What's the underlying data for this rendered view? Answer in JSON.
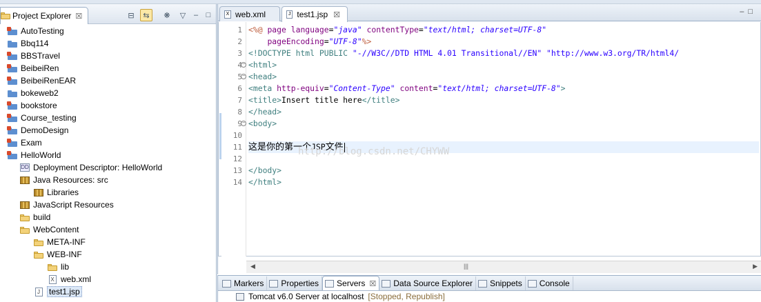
{
  "explorer": {
    "tab_label": "Project Explorer",
    "tab_close": "☒",
    "toolbar": {
      "collapse_all": "⊟",
      "link_editor": "⇆",
      "filter": "❋",
      "menu": "▽",
      "minimize": "–",
      "maximize": "□"
    },
    "tree": [
      {
        "label": "AutoTesting",
        "icon": "project-error-icon",
        "depth": 0
      },
      {
        "label": "Bbq114",
        "icon": "project-icon",
        "depth": 0
      },
      {
        "label": "BBSTravel",
        "icon": "web-project-icon",
        "depth": 0
      },
      {
        "label": "BeibeiRen",
        "icon": "web-project-icon",
        "depth": 0
      },
      {
        "label": "BeibeiRenEAR",
        "icon": "ear-project-icon",
        "depth": 0
      },
      {
        "label": "bokeweb2",
        "icon": "project-icon",
        "depth": 0
      },
      {
        "label": "bookstore",
        "icon": "project-error-icon",
        "depth": 0
      },
      {
        "label": "Course_testing",
        "icon": "web-project-icon",
        "depth": 0
      },
      {
        "label": "DemoDesign",
        "icon": "web-project-icon",
        "depth": 0
      },
      {
        "label": "Exam",
        "icon": "web-project-icon",
        "depth": 0
      },
      {
        "label": "HelloWorld",
        "icon": "web-project-icon",
        "depth": 0
      },
      {
        "label": "Deployment Descriptor: HelloWorld",
        "icon": "deployment-descriptor-icon",
        "depth": 1
      },
      {
        "label": "Java Resources: src",
        "icon": "java-resources-icon",
        "depth": 1
      },
      {
        "label": "Libraries",
        "icon": "library-icon",
        "depth": 2
      },
      {
        "label": "JavaScript Resources",
        "icon": "javascript-resources-icon",
        "depth": 1
      },
      {
        "label": "build",
        "icon": "folder-icon",
        "depth": 1
      },
      {
        "label": "WebContent",
        "icon": "folder-icon",
        "depth": 1
      },
      {
        "label": "META-INF",
        "icon": "folder-icon",
        "depth": 2
      },
      {
        "label": "WEB-INF",
        "icon": "folder-icon",
        "depth": 2
      },
      {
        "label": "lib",
        "icon": "folder-icon",
        "depth": 3
      },
      {
        "label": "web.xml",
        "icon": "xml-file-icon",
        "depth": 3
      },
      {
        "label": "test1.jsp",
        "icon": "jsp-file-icon",
        "depth": 2,
        "selected": true
      }
    ]
  },
  "editor": {
    "tabs": [
      {
        "label": "web.xml",
        "icon_text": "X",
        "active": false
      },
      {
        "label": "test1.jsp",
        "icon_text": "J",
        "active": true
      }
    ],
    "tab_close": "☒",
    "minmax": "–□",
    "watermark": "http://blog.csdn.net/CHYWW",
    "line_numbers": [
      "1",
      "2",
      "3",
      "4",
      "5",
      "6",
      "7",
      "8",
      "9",
      "10",
      "11",
      "12",
      "13",
      "14"
    ],
    "fold_lines": [
      4,
      5,
      9
    ],
    "current_line": 11,
    "code": [
      [
        [
          "dir",
          "<%@ "
        ],
        [
          "attr",
          "page "
        ],
        [
          "attr",
          "language"
        ],
        [
          "plain",
          "="
        ],
        [
          "str",
          "\"java\""
        ],
        [
          "plain",
          " "
        ],
        [
          "attr",
          "contentType"
        ],
        [
          "plain",
          "="
        ],
        [
          "str",
          "\"text/html; charset=UTF-8\""
        ]
      ],
      [
        [
          "plain",
          "    "
        ],
        [
          "attr",
          "pageEncoding"
        ],
        [
          "plain",
          "="
        ],
        [
          "str",
          "\"UTF-8\""
        ],
        [
          "dir",
          "%>"
        ]
      ],
      [
        [
          "doc",
          "<!DOCTYPE html PUBLIC "
        ],
        [
          "str2",
          "\"-//W3C//DTD HTML 4.01 Transitional//EN\""
        ],
        [
          "plain",
          " "
        ],
        [
          "str2",
          "\"http://www.w3.org/TR/html4/"
        ]
      ],
      [
        [
          "tag",
          "<html>"
        ]
      ],
      [
        [
          "tag",
          "<head>"
        ]
      ],
      [
        [
          "tag",
          "<meta "
        ],
        [
          "attr",
          "http-equiv"
        ],
        [
          "plain",
          "="
        ],
        [
          "str",
          "\"Content-Type\""
        ],
        [
          "plain",
          " "
        ],
        [
          "attr",
          "content"
        ],
        [
          "plain",
          "="
        ],
        [
          "str",
          "\"text/html; charset=UTF-8\""
        ],
        [
          "tag",
          ">"
        ]
      ],
      [
        [
          "tag",
          "<title>"
        ],
        [
          "plain",
          "Insert title here"
        ],
        [
          "tag",
          "</title>"
        ]
      ],
      [
        [
          "tag",
          "</head>"
        ]
      ],
      [
        [
          "tag",
          "<body>"
        ]
      ],
      [],
      [
        [
          "cjk",
          "这是你的第一个"
        ],
        [
          "plain",
          "JSP"
        ],
        [
          "cjk",
          "文件"
        ]
      ],
      [],
      [
        [
          "tag",
          "</body>"
        ]
      ],
      [
        [
          "tag",
          "</html>"
        ]
      ]
    ],
    "hscroll": {
      "left": "◀",
      "right": "▶",
      "grip": "|||"
    }
  },
  "bottom": {
    "tabs": [
      {
        "label": "Markers",
        "name": "markers",
        "active": false
      },
      {
        "label": "Properties",
        "name": "properties",
        "active": false
      },
      {
        "label": "Servers",
        "name": "servers",
        "active": true
      },
      {
        "label": "Data Source Explorer",
        "name": "data-source-explorer",
        "active": false
      },
      {
        "label": "Snippets",
        "name": "snippets",
        "active": false
      },
      {
        "label": "Console",
        "name": "console",
        "active": false
      }
    ],
    "tab_close": "☒",
    "server": {
      "name": "Tomcat v6.0 Server at localhost",
      "status": "[Stopped, Republish]"
    }
  }
}
